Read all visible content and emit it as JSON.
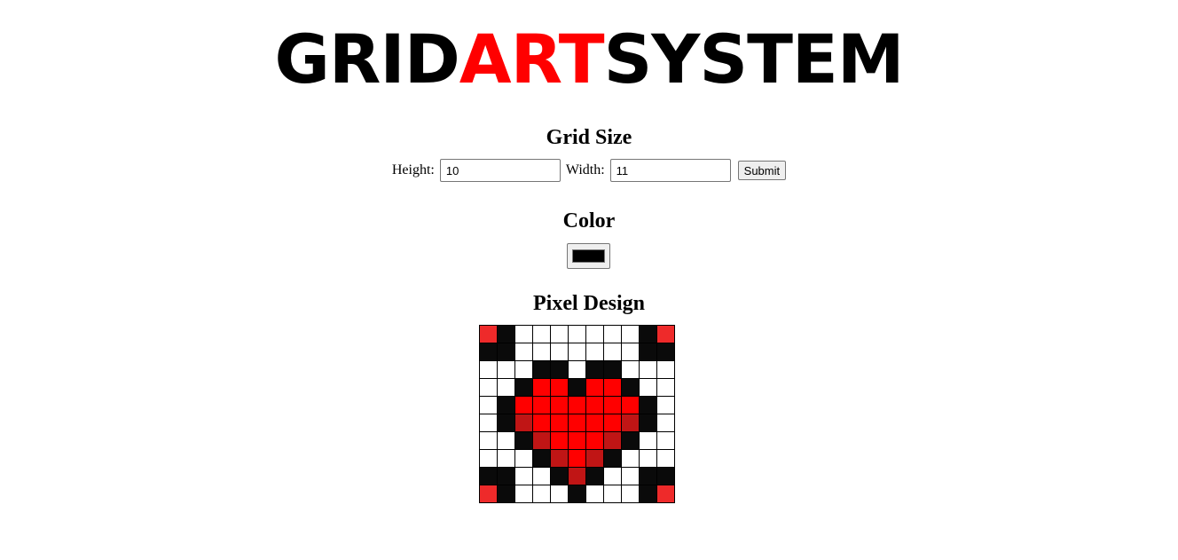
{
  "logo": {
    "part1": "GRID",
    "part2": "ART",
    "part3": "SYSTEM"
  },
  "grid_size": {
    "heading": "Grid Size",
    "height_label": "Height:",
    "height_value": "10",
    "width_label": "Width:",
    "width_value": "11",
    "submit_label": "Submit"
  },
  "color": {
    "heading": "Color",
    "value": "#000000"
  },
  "pixel_design": {
    "heading": "Pixel Design",
    "palette": {
      "W": "#ffffff",
      "K": "#0a0a0a",
      "R": "#ff0000",
      "D": "#c01515",
      "L": "#ee2a2a"
    },
    "rows": [
      "LKWWWWWWWKL",
      "KKWWWWWWWKK",
      "WWWKKWKKWWW",
      "WWKRRKRRKWW",
      "WKRRRRRRRKW",
      "WKDRRRRRDKW",
      "WWKDRRRDKWW",
      "WWWKDRDKWWW",
      "KKWWKDKWWKK",
      "LKWWWKWWWKL"
    ]
  }
}
